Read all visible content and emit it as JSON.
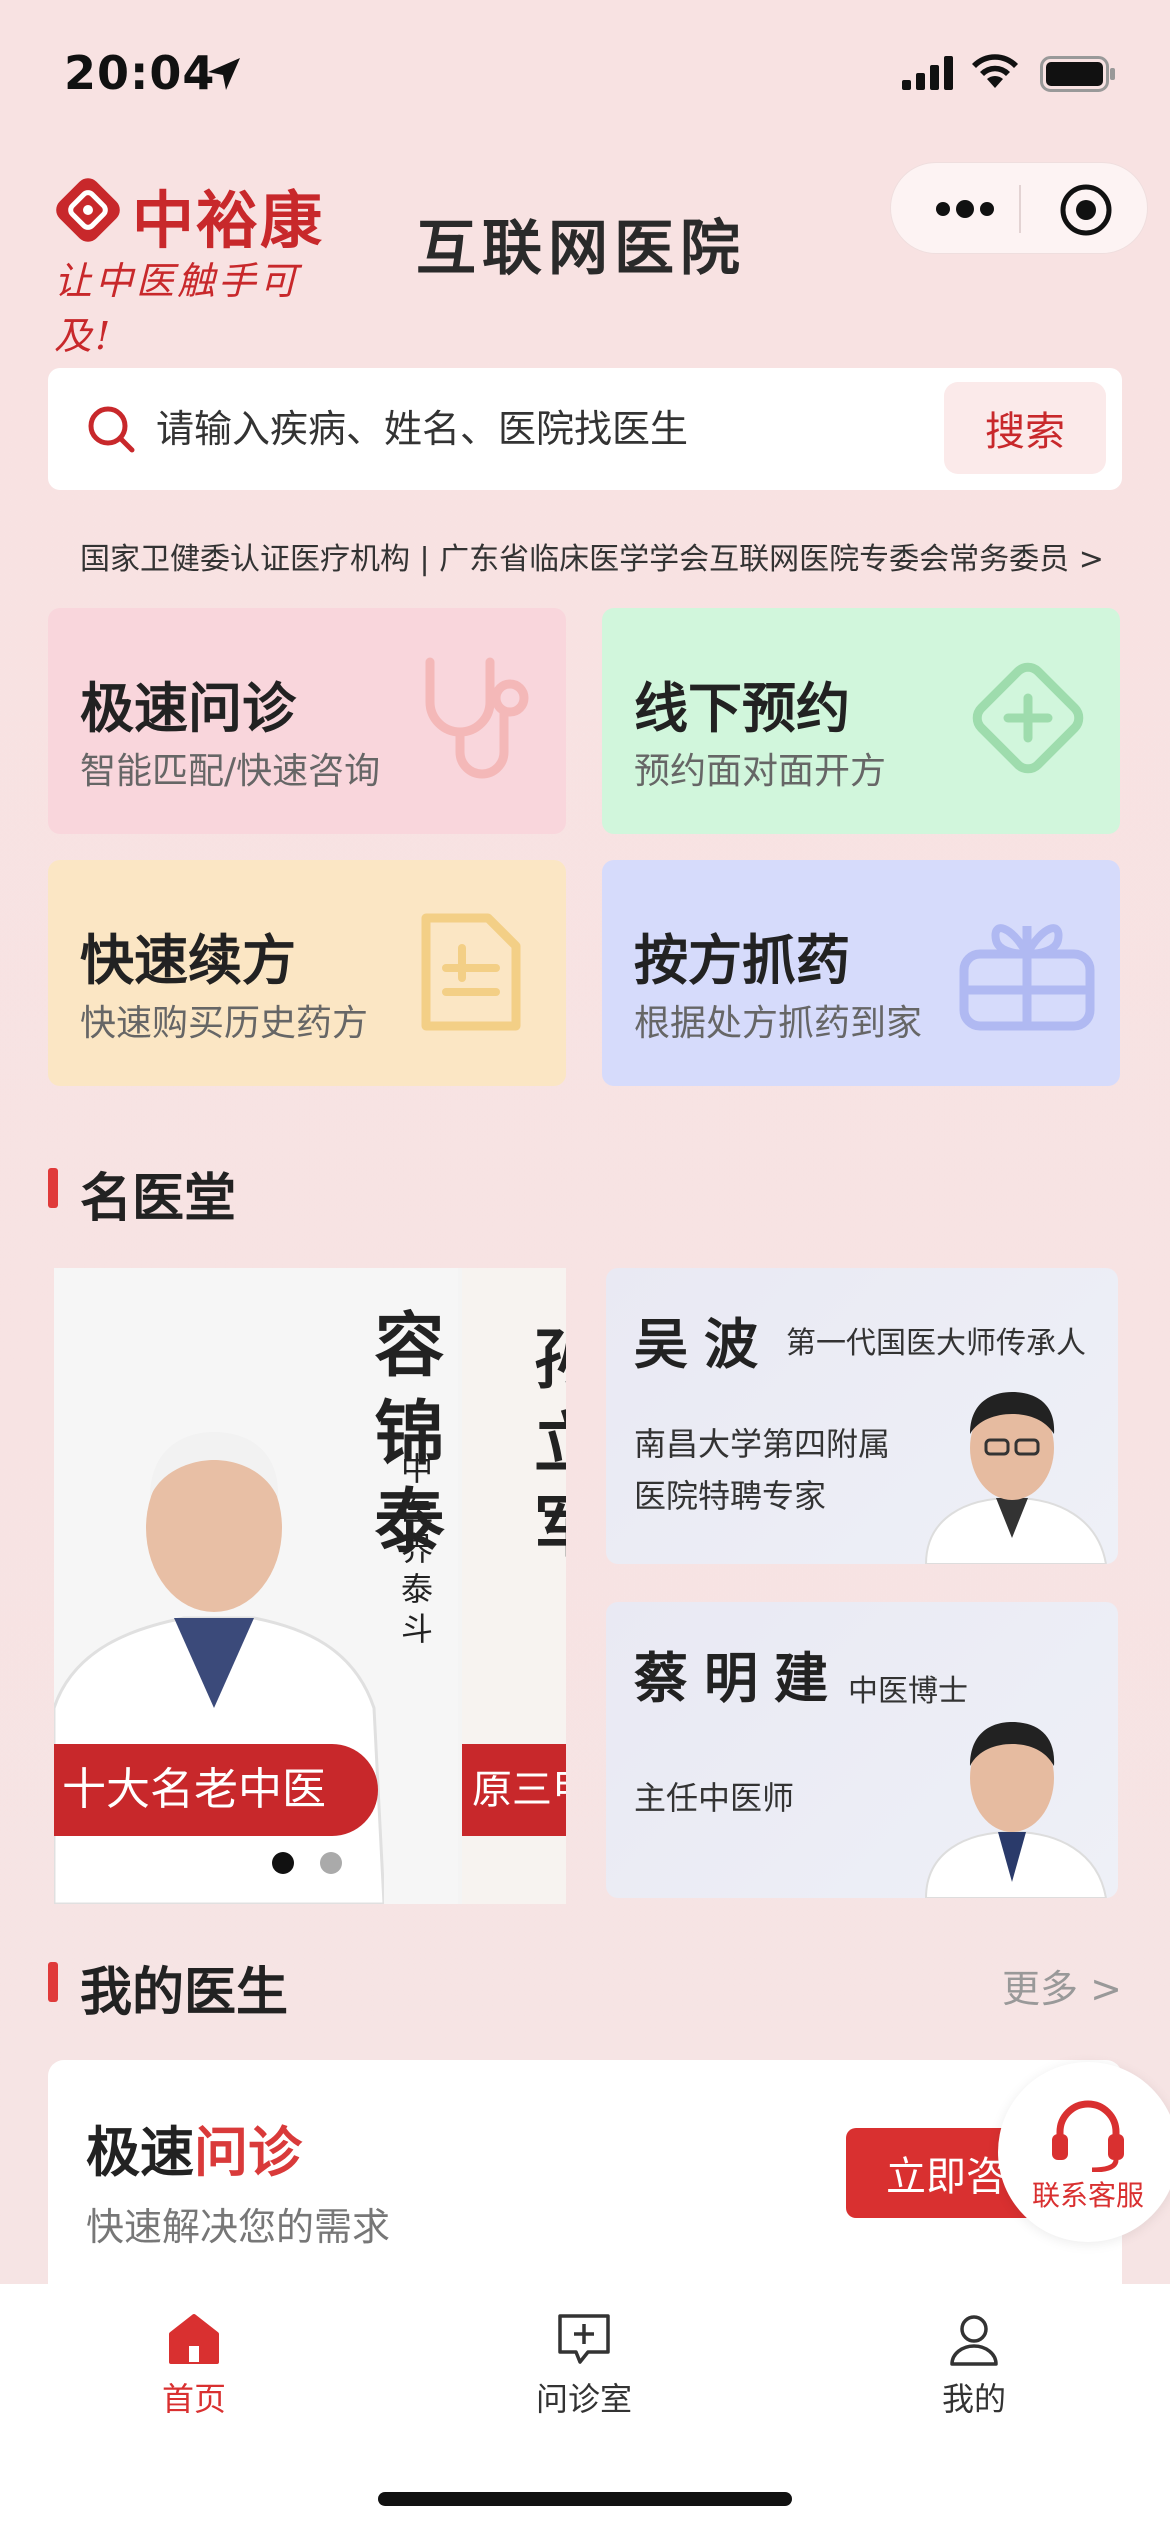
{
  "status": {
    "time": "20:04"
  },
  "header": {
    "logo_name": "中裕康",
    "logo_slogan": "让中医触手可及!",
    "hospital_title": "互联网医院"
  },
  "search": {
    "placeholder": "请输入疾病、姓名、医院找医生",
    "button": "搜索"
  },
  "notice": "国家卫健委认证医疗机构 | 广东省临床医学学会互联网医院专委会常务委员 >",
  "services": [
    {
      "title": "极速问诊",
      "subtitle": "智能匹配/快速咨询",
      "icon": "stethoscope-icon"
    },
    {
      "title": "线下预约",
      "subtitle": "预约面对面开方",
      "icon": "plus-diamond-icon"
    },
    {
      "title": "快速续方",
      "subtitle": "快速购买历史药方",
      "icon": "document-icon"
    },
    {
      "title": "按方抓药",
      "subtitle": "根据处方抓药到家",
      "icon": "gift-icon"
    }
  ],
  "famous": {
    "title": "名医堂",
    "banner": [
      {
        "name": "容锦泰",
        "subtitle": "中医界泰斗",
        "tag": "十大名老中医"
      },
      {
        "name": "孙立军",
        "tag": "原三甲"
      }
    ],
    "doctors": [
      {
        "name": "吴波",
        "tag": "第一代国医大师传承人",
        "desc_lines": [
          "南昌大学第四附属",
          "医院特聘专家"
        ]
      },
      {
        "name": "蔡明建",
        "tag": "中医博士",
        "desc_lines": [
          "主任中医师"
        ]
      }
    ]
  },
  "my_doctor": {
    "title": "我的医生",
    "more": "更多 >",
    "card_title_a": "极速",
    "card_title_b": "问诊",
    "card_sub": "快速解决您的需求",
    "button": "立即咨"
  },
  "customer_service": "联系客服",
  "tabs": [
    {
      "label": "首页",
      "active": true
    },
    {
      "label": "问诊室",
      "active": false
    },
    {
      "label": "我的",
      "active": false
    }
  ],
  "colors": {
    "brand": "#c8282b",
    "accent": "#d93030",
    "background": "#f8e2e2"
  }
}
